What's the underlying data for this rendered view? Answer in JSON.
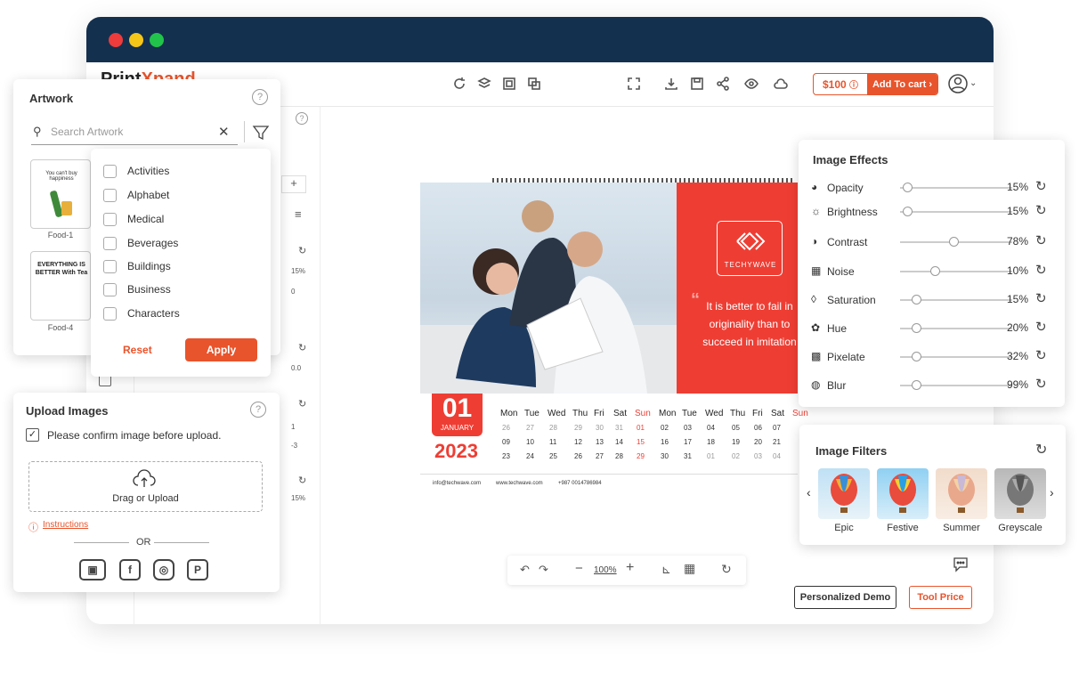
{
  "app": {
    "logo_main": "Print",
    "logo_x": "Xpand"
  },
  "toolbar": {
    "price": "$100",
    "add_to_cart": "Add To cart"
  },
  "artwork": {
    "title": "Artwork",
    "search_placeholder": "Search Artwork",
    "thumbs": [
      {
        "label": "Food-1",
        "text": "You can't buy happiness"
      },
      {
        "label": "Food-4",
        "text": "EVERYTHING IS BETTER With Tea"
      }
    ]
  },
  "filters": {
    "items": [
      "Activities",
      "Alphabet",
      "Medical",
      "Beverages",
      "Buildings",
      "Business",
      "Characters"
    ],
    "reset": "Reset",
    "apply": "Apply"
  },
  "upload": {
    "title": "Upload Images",
    "confirm": "Please confirm image before upload.",
    "drop": "Drag or Upload",
    "instructions": "Instructions",
    "or": "OR"
  },
  "effects": {
    "title": "Image Effects",
    "rows": [
      {
        "name": "Opacity",
        "value": "15%",
        "level": 0.02
      },
      {
        "name": "Brightness",
        "value": "15%",
        "level": 0.02
      },
      {
        "name": "Contrast",
        "value": "78%",
        "level": 0.44
      },
      {
        "name": "Noise",
        "value": "10%",
        "level": 0.27
      },
      {
        "name": "Saturation",
        "value": "15%",
        "level": 0.1
      },
      {
        "name": "Hue",
        "value": "20%",
        "level": 0.1
      },
      {
        "name": "Pixelate",
        "value": "32%",
        "level": 0.1
      },
      {
        "name": "Blur",
        "value": "99%",
        "level": 0.1
      }
    ]
  },
  "image_filters": {
    "title": "Image Filters",
    "items": [
      "Epic",
      "Festive",
      "Summer",
      "Greyscale"
    ]
  },
  "calendar": {
    "brand": "TECHYWAVE",
    "quote": "It is better to fail in originality than to succeed in imitation",
    "day": "01",
    "month": "JANUARY",
    "year": "2023",
    "headers": [
      "Mon",
      "Tue",
      "Wed",
      "Thu",
      "Fri",
      "Sat",
      "Sun",
      "Mon",
      "Tue",
      "Wed",
      "Thu",
      "Fri",
      "Sat",
      "Sun"
    ],
    "rows": [
      [
        "26",
        "27",
        "28",
        "29",
        "30",
        "31",
        "01",
        "02",
        "03",
        "04",
        "05",
        "06",
        "07",
        ""
      ],
      [
        "09",
        "10",
        "11",
        "12",
        "13",
        "14",
        "15",
        "16",
        "17",
        "18",
        "19",
        "20",
        "21",
        ""
      ],
      [
        "23",
        "24",
        "25",
        "26",
        "27",
        "28",
        "29",
        "30",
        "31",
        "01",
        "02",
        "03",
        "04",
        ""
      ]
    ],
    "email": "info@techwave.com",
    "web": "www.techwave.com",
    "phone": "+987 0014786984"
  },
  "zoom": {
    "level": "100%"
  },
  "sidepanel": {
    "v1": "15%",
    "v2": "0",
    "v3": "0.0",
    "v4": "1",
    "v5": "-3",
    "v6": "15%"
  },
  "buttons": {
    "demo": "Personalized Demo",
    "tool_price": "Tool Price"
  }
}
